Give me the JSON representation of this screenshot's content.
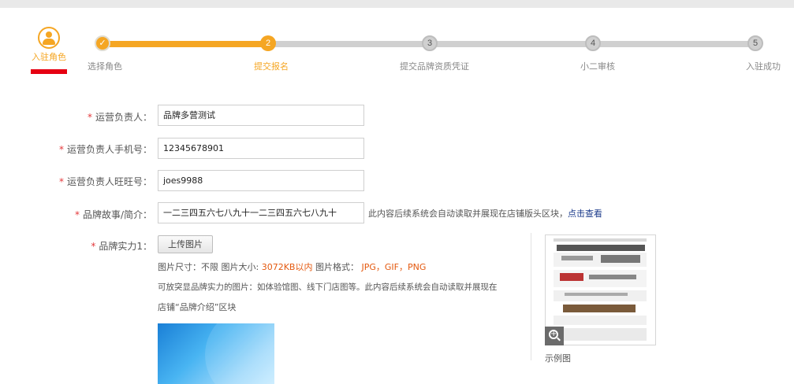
{
  "role": {
    "label": "入驻角色"
  },
  "progress": {
    "steps": [
      {
        "number": "",
        "label": "选择角色"
      },
      {
        "number": "2",
        "label": "提交报名"
      },
      {
        "number": "3",
        "label": "提交品牌资质凭证"
      },
      {
        "number": "4",
        "label": "小二审核"
      },
      {
        "number": "5",
        "label": "入驻成功"
      }
    ]
  },
  "form": {
    "required_mark": "*",
    "fields": [
      {
        "label": "运营负责人：",
        "value": "品牌多营测试"
      },
      {
        "label": "运营负责人手机号：",
        "value": "12345678901"
      },
      {
        "label": "运营负责人旺旺号：",
        "value": "joes9988"
      },
      {
        "label": "品牌故事/简介：",
        "value": "一二三四五六七八九十一二三四五六七八九十"
      }
    ],
    "story_hint": "此内容后续系统会自动读取并展现在店铺版头区块，",
    "story_link": "点击查看",
    "strength": {
      "label": "品牌实力1：",
      "upload_button": "上传图片",
      "size_label": "图片尺寸：不限  图片大小:",
      "size_value": "3072KB以内",
      "format_label": "图片格式：",
      "format_value": "JPG，GIF，PNG",
      "desc_line1": "可放突显品牌实力的图片：如体验馆图、线下门店图等。此内容后续系统会自动读取并展现在",
      "desc_line2": "店铺“品牌介绍”区块"
    }
  },
  "sample": {
    "caption": "示例图",
    "zoom_icon": "zoom-in-icon"
  },
  "colors": {
    "accent": "#f5a623",
    "required": "#e4393c",
    "link": "#1a3a8a",
    "highlight": "#e4590f"
  }
}
